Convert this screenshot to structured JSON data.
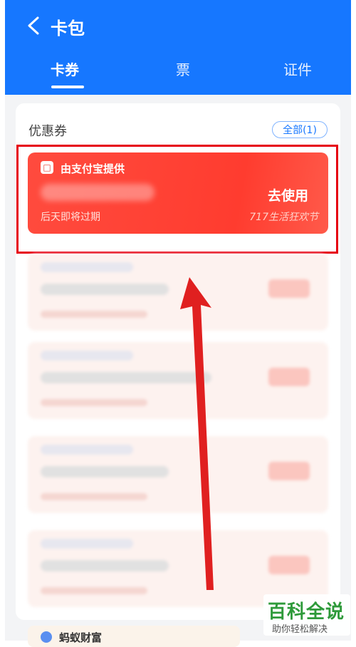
{
  "header": {
    "title": "卡包",
    "tabs": [
      {
        "label": "卡券",
        "active": true
      },
      {
        "label": "票",
        "active": false
      },
      {
        "label": "证件",
        "active": false
      }
    ]
  },
  "section": {
    "title": "优惠券",
    "all_button": "全部(1)"
  },
  "coupon": {
    "provider": "由支付宝提供",
    "action": "去使用",
    "expire": "后天即将过期",
    "brand": "717生活狂欢节"
  },
  "bottom_card": {
    "provider": "蚂蚁财富"
  },
  "watermark": {
    "main": "百科全说",
    "sub": "助你轻松解决"
  },
  "colors": {
    "header": "#1677ff",
    "coupon": "#ff4b3e",
    "highlight": "#e60012",
    "arrow": "#e02020"
  }
}
